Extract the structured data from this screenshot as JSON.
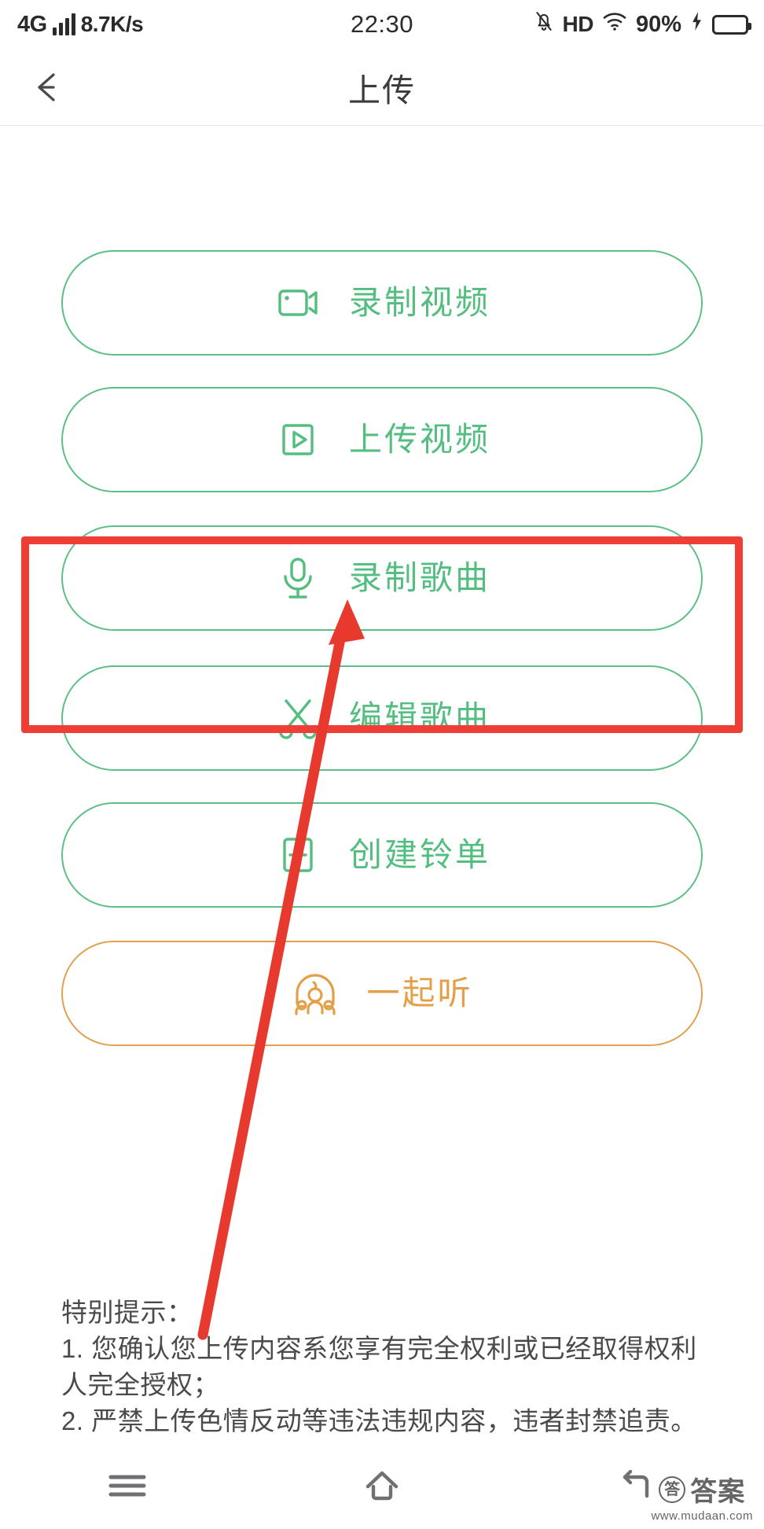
{
  "status_bar": {
    "network_type": "4G",
    "net_speed": "8.7K/s",
    "time": "22:30",
    "hd_label": "HD",
    "battery_percent": "90%",
    "signal_icon": "signal-bars-icon",
    "mute_icon": "bell-muted-icon",
    "wifi_icon": "wifi-icon",
    "charging_icon": "charging-bolt-icon",
    "battery_icon": "battery-icon"
  },
  "header": {
    "title": "上传",
    "back_icon": "back-arrow-icon"
  },
  "options": [
    {
      "label": "录制视频",
      "icon": "video-camera-icon",
      "color": "#54bd80",
      "border": "#5cbf85",
      "theme": "green"
    },
    {
      "label": "上传视频",
      "icon": "play-square-icon",
      "color": "#54bd80",
      "border": "#5cbf85",
      "theme": "green"
    },
    {
      "label": "录制歌曲",
      "icon": "microphone-icon",
      "color": "#54bd80",
      "border": "#5cbf85",
      "theme": "green"
    },
    {
      "label": "编辑歌曲",
      "icon": "scissors-icon",
      "color": "#54bd80",
      "border": "#5cbf85",
      "theme": "green"
    },
    {
      "label": "创建铃单",
      "icon": "plus-square-icon",
      "color": "#54bd80",
      "border": "#5cbf85",
      "theme": "green"
    },
    {
      "label": "一起听",
      "icon": "listen-together-icon",
      "color": "#e4a048",
      "border": "#e0a050",
      "theme": "orange"
    }
  ],
  "annotation": {
    "highlight_color": "#ef3e36",
    "highlight_target": "录制歌曲",
    "arrow_icon": "pointer-arrow-icon"
  },
  "notice": {
    "heading": "特别提示：",
    "line1": "1. 您确认您上传内容系您享有完全权利或已经取得权利",
    "line2": "人完全授权；",
    "line3": "2. 严禁上传色情反动等违法违规内容，违者封禁追责。"
  },
  "navbar": {
    "menu_icon": "menu-icon",
    "home_icon": "home-icon",
    "back_icon": "back-nav-icon"
  },
  "watermark": {
    "badge": "答",
    "text": "答案",
    "url": "www.mudaan.com"
  }
}
